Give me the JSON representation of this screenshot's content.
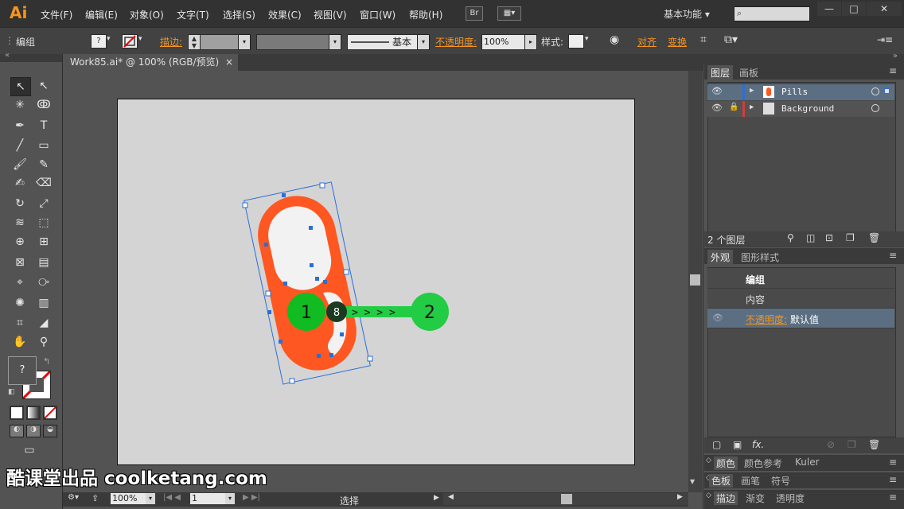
{
  "app": {
    "logo": "Ai"
  },
  "menu": [
    "文件(F)",
    "编辑(E)",
    "对象(O)",
    "文字(T)",
    "选择(S)",
    "效果(C)",
    "视图(V)",
    "窗口(W)",
    "帮助(H)"
  ],
  "bridge": "Br",
  "workspace": "基本功能",
  "window_controls": [
    "—",
    "□",
    "✕"
  ],
  "control_bar": {
    "selection_type": "编组",
    "stroke_label": "描边:",
    "brush_label": "基本",
    "opacity_label": "不透明度:",
    "opacity_value": "100%",
    "style_label": "样式:",
    "align_label": "对齐",
    "transform_label": "变换"
  },
  "document": {
    "tab_title": "Work85.ai* @ 100% (RGB/预览)",
    "close": "×"
  },
  "artwork": {
    "pill_color": "#ff5722",
    "marker1": "1",
    "marker2": "2",
    "marker_badge": "8",
    "drag_arrows": "> > > >",
    "marker_color": "#22cc44"
  },
  "layers_panel": {
    "tabs": [
      "图层",
      "画板"
    ],
    "layers": [
      {
        "name": "Pills",
        "color": "#2b6ed6"
      },
      {
        "name": "Background",
        "color": "#d63b3b"
      }
    ],
    "footer": "2 个图层"
  },
  "appearance_panel": {
    "tabs": [
      "外观",
      "图形样式"
    ],
    "title": "编组",
    "contents": "内容",
    "opacity_label": "不透明度:",
    "opacity_value": "默认值",
    "fx": "fx."
  },
  "collapsed_panels": [
    [
      "颜色",
      "颜色参考",
      "Kuler"
    ],
    [
      "色板",
      "画笔",
      "符号"
    ],
    [
      "描边",
      "渐变",
      "透明度"
    ]
  ],
  "status": {
    "zoom": "100%",
    "page": "1",
    "tool": "选择"
  },
  "watermark": "酷课堂出品 coolketang.com"
}
